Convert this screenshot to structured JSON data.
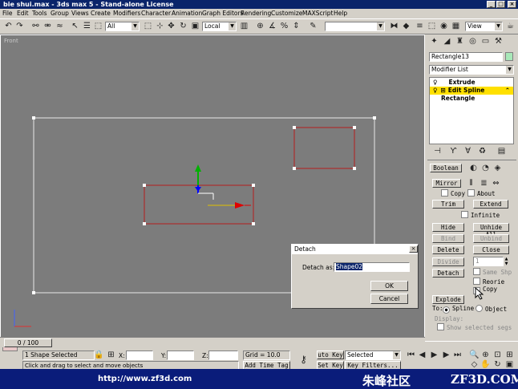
{
  "window": {
    "title": "bie shui.max - 3ds max 5 - Stand-alone License"
  },
  "menu": [
    "File",
    "Edit",
    "Tools",
    "Group",
    "Views",
    "Create",
    "Modifiers",
    "Character",
    "Animation",
    "Graph Editors",
    "Rendering",
    "Customize",
    "MAXScript",
    "Help"
  ],
  "toolbar": {
    "filter_combo": "All",
    "coord_combo": "Local",
    "selection_set": "",
    "render_combo": "View"
  },
  "viewport": {
    "label": "Front"
  },
  "command_panel": {
    "object_name": "Rectangle13",
    "modifier_list": "Modifier List",
    "stack": [
      "Extrude",
      "Edit Spline",
      "Rectangle"
    ],
    "buttons": {
      "boolean": "Boolean",
      "mirror": "Mirror",
      "copy": "Copy",
      "about": "About",
      "trim": "Trim",
      "extend": "Extend",
      "infinite": "Infinite",
      "hide": "Hide",
      "unhide_all": "Unhide All",
      "bind": "Bind",
      "unbind": "Unbind",
      "delete": "Delete",
      "close": "Close",
      "divide": "Divide",
      "divide_value": "1",
      "detach": "Detach",
      "same_shp": "Same Shp",
      "reorient": "Reorie",
      "copy2": "Copy",
      "explode": "Explode",
      "to_label": "To:",
      "spline": "Spline",
      "object": "Object",
      "display_label": "Display:",
      "show_segs": "Show selected segs"
    }
  },
  "dialog": {
    "title": "Detach",
    "label": "Detach as:",
    "value": "Shape02",
    "ok": "OK",
    "cancel": "Cancel"
  },
  "status": {
    "selected": "1 Shape Selected",
    "x_label": "X:",
    "y_label": "Y:",
    "z_label": "Z:",
    "grid": "Grid = 10.0",
    "auto_key": "uto Key",
    "set_key": "Set Key",
    "selected_combo": "Selected",
    "key_filters": "Key Filters...",
    "time_slider": "0 / 100",
    "prompt": "Click and drag to select and move objects",
    "add_time_tag": "Add Time Tag"
  },
  "banner": {
    "url": "http://www.zf3d.com",
    "name": "朱峰社区",
    "site": "ZF3D.COM"
  }
}
